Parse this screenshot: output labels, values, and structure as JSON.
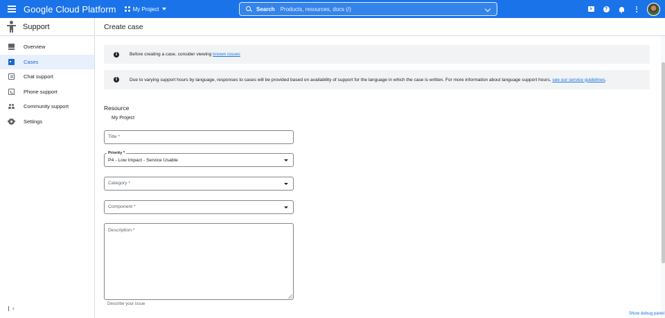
{
  "topbar": {
    "brand": "Google Cloud Platform",
    "project": "My Project",
    "search_label": "Search",
    "search_placeholder": "Products, resources, docs (/)",
    "accent_color": "#1a73e8"
  },
  "sidebar": {
    "title": "Support",
    "items": [
      {
        "label": "Overview",
        "icon": "grid-icon"
      },
      {
        "label": "Cases",
        "icon": "cases-icon",
        "active": true
      },
      {
        "label": "Chat support",
        "icon": "chat-icon"
      },
      {
        "label": "Phone support",
        "icon": "phone-icon"
      },
      {
        "label": "Community support",
        "icon": "community-icon"
      },
      {
        "label": "Settings",
        "icon": "gear-icon"
      }
    ],
    "collapse_glyph": "‹"
  },
  "main": {
    "title": "Create case",
    "notice1": {
      "text": "Before creating a case, consider viewing ",
      "link": "known issues"
    },
    "notice2": {
      "text": "Due to varying support hours by language, responses to cases will be provided based on availability of support for the language in which the case is written. For more information about language support hours, ",
      "link": "see our service guidelines",
      "suffix": "."
    },
    "resource": {
      "label": "Resource",
      "value": "My Project"
    },
    "form": {
      "title_placeholder": "Title *",
      "priority_label": "Priority *",
      "priority_value": "P4 - Low Impact - Service Usable",
      "category_placeholder": "Category *",
      "component_placeholder": "Component *",
      "description_placeholder": "Description *",
      "description_helper": "Describe your issue"
    },
    "debug_link": "Show debug panel"
  }
}
